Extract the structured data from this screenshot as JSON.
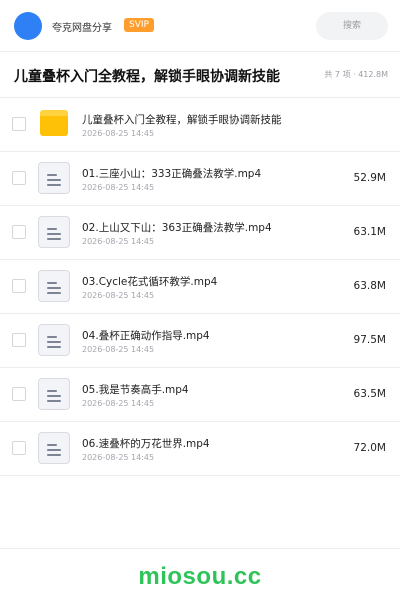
{
  "header": {
    "app_name": "夸克网盘分享",
    "badge": "SVIP",
    "search_placeholder": "搜索"
  },
  "share": {
    "title": "儿童叠杯入门全教程，解锁手眼协调新技能",
    "meta": "共 7 项 · 412.8M"
  },
  "files": [
    {
      "type": "folder",
      "name": "儿童叠杯入门全教程，解锁手眼协调新技能",
      "date": "2026-08-25 14:45",
      "size": ""
    },
    {
      "type": "file",
      "name": "01.三座小山：333正确叠法教学.mp4",
      "date": "2026-08-25 14:45",
      "size": "52.9M"
    },
    {
      "type": "file",
      "name": "02.上山又下山：363正确叠法教学.mp4",
      "date": "2026-08-25 14:45",
      "size": "63.1M"
    },
    {
      "type": "file",
      "name": "03.Cycle花式循环教学.mp4",
      "date": "2026-08-25 14:45",
      "size": "63.8M"
    },
    {
      "type": "file",
      "name": "04.叠杯正确动作指导.mp4",
      "date": "2026-08-25 14:45",
      "size": "97.5M"
    },
    {
      "type": "file",
      "name": "05.我是节奏高手.mp4",
      "date": "2026-08-25 14:45",
      "size": "63.5M"
    },
    {
      "type": "file",
      "name": "06.速叠杯的万花世界.mp4",
      "date": "2026-08-25 14:45",
      "size": "72.0M"
    }
  ],
  "footer": {
    "watermark": "miosou.cc"
  },
  "colors": {
    "brand_blue": "#2f80f5",
    "svip_orange": "#ff9e2c",
    "folder_yellow": "#ffc107",
    "watermark_green": "#2fc45a"
  },
  "icons": {
    "folder": "folder-icon",
    "file": "document-icon"
  }
}
